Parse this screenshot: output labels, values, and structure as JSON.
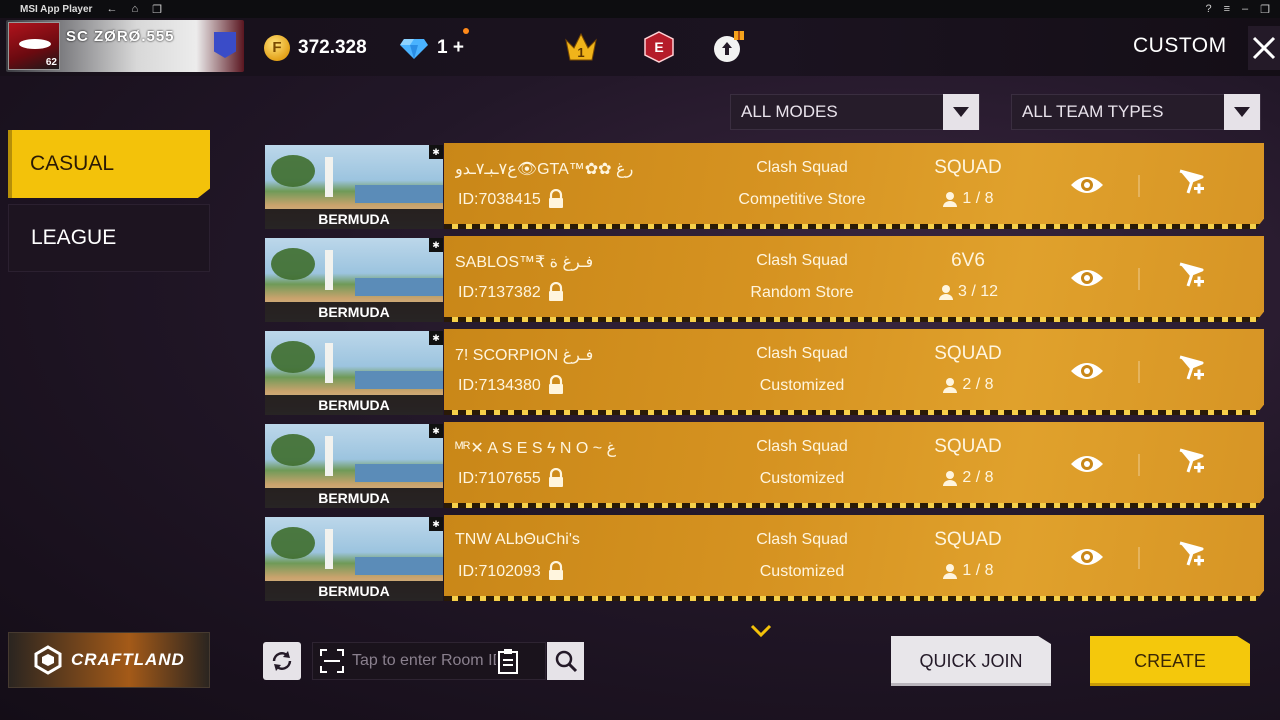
{
  "window": {
    "app_title": "MSI App Player"
  },
  "topbar": {
    "player_name": "SC  ZØRØ.555",
    "player_level": "62",
    "gold": "372.328",
    "diamonds": "1",
    "diamond_plus": "+",
    "page_label": "CUSTOM",
    "icons": [
      "rank-crown-icon",
      "elite-pass-icon",
      "gift-upload-icon",
      "close-icon"
    ]
  },
  "filters": {
    "modes": "ALL MODES",
    "team_types": "ALL TEAM TYPES"
  },
  "tabs": {
    "casual": "CASUAL",
    "league": "LEAGUE"
  },
  "rooms": [
    {
      "map": "BERMUDA",
      "name": "ع٧ـبـ٧ـدو👁GTA™✿✿ رغ",
      "id": "ID:7038415",
      "mode": "Clash Squad",
      "store": "Competitive Store",
      "team": "SQUAD",
      "count": "1 / 8"
    },
    {
      "map": "BERMUDA",
      "name": "SABLOS™₹ فـرغ ة",
      "id": "ID:7137382",
      "mode": "Clash Squad",
      "store": "Random Store",
      "team": "6V6",
      "count": "3 / 12"
    },
    {
      "map": "BERMUDA",
      "name": "7!    SCORPION فـرغ",
      "id": "ID:7134380",
      "mode": "Clash Squad",
      "store": "Customized",
      "team": "SQUAD",
      "count": "2 / 8"
    },
    {
      "map": "BERMUDA",
      "name": "ᴹᴿ✕ A S E S ϟ N O ~ غ",
      "id": "ID:7107655",
      "mode": "Clash Squad",
      "store": "Customized",
      "team": "SQUAD",
      "count": "2 / 8"
    },
    {
      "map": "BERMUDA",
      "name": "TNW    ALbΘuChi's",
      "id": "ID:7102093",
      "mode": "Clash Squad",
      "store": "Customized",
      "team": "SQUAD",
      "count": "1 / 8"
    }
  ],
  "bottom": {
    "craftland": "CRAFTLAND",
    "room_input_placeholder": "Tap to enter Room ID",
    "quick_join": "QUICK JOIN",
    "create": "CREATE"
  },
  "colors": {
    "accent_yellow": "#f3c20a",
    "card_gold": "#d69321",
    "background": "#221728"
  }
}
